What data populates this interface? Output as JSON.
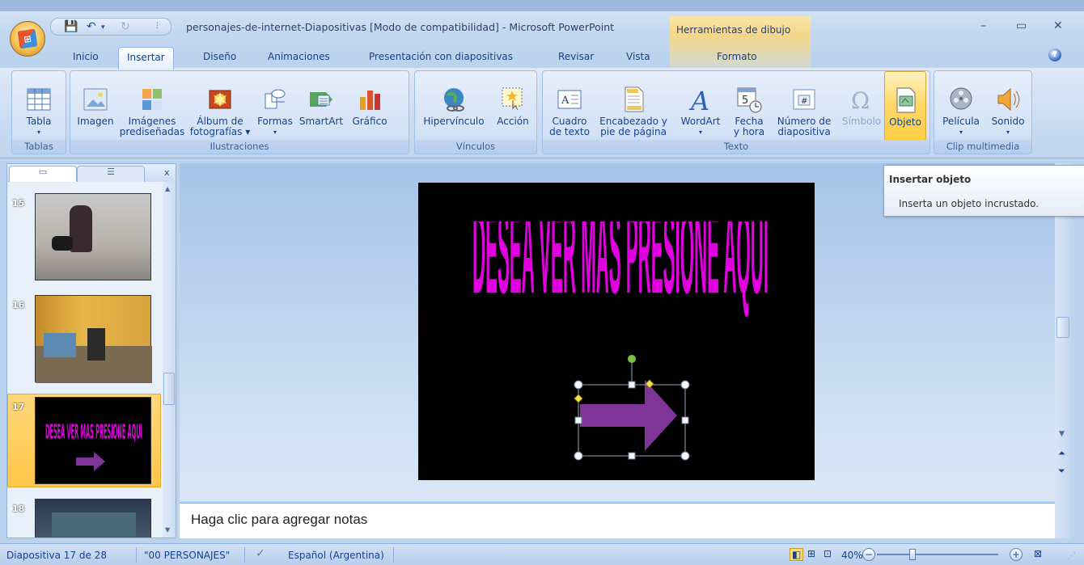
{
  "window": {
    "title": "personajes-de-internet-Diapositivas [Modo de compatibilidad] - Microsoft PowerPoint",
    "context_group": "Herramientas de dibujo"
  },
  "tabs": [
    "Inicio",
    "Insertar",
    "Diseño",
    "Animaciones",
    "Presentación con diapositivas",
    "Revisar",
    "Vista",
    "Formato"
  ],
  "ribbon": {
    "groups": {
      "tablas": "Tablas",
      "ilustraciones": "Ilustraciones",
      "vinculos": "Vínculos",
      "texto": "Texto",
      "clip": "Clip multimedia"
    },
    "buttons": {
      "tabla": "Tabla",
      "imagen": "Imagen",
      "imagenes_1": "Imágenes",
      "imagenes_2": "prediseñadas",
      "album_1": "Álbum de",
      "album_2": "fotografías",
      "formas": "Formas",
      "smartart": "SmartArt",
      "grafico": "Gráfico",
      "hipervinculo": "Hipervínculo",
      "accion": "Acción",
      "cuadro_1": "Cuadro",
      "cuadro_2": "de texto",
      "encabezado_1": "Encabezado y",
      "encabezado_2": "pie de página",
      "wordart": "WordArt",
      "fecha_1": "Fecha",
      "fecha_2": "y hora",
      "numero_1": "Número de",
      "numero_2": "diapositiva",
      "simbolo": "Símbolo",
      "objeto": "Objeto",
      "pelicula": "Película",
      "sonido": "Sonido"
    }
  },
  "tooltip": {
    "title": "Insertar objeto",
    "description": "Inserta un objeto incrustado."
  },
  "thumbnails": [
    {
      "number": "15"
    },
    {
      "number": "16"
    },
    {
      "number": "17"
    },
    {
      "number": "18"
    }
  ],
  "slide": {
    "wordart_text": "DESEA VER MAS PRESIONE AQUI",
    "wordart_color": "#e000e0",
    "arrow_color": "#7f3598"
  },
  "notes": {
    "placeholder": "Haga clic para agregar notas"
  },
  "status": {
    "slide": "Diapositiva 17 de 28",
    "theme": "\"00 PERSONAJES\"",
    "language": "Español (Argentina)",
    "zoom": "40%"
  },
  "colors": {
    "ribbon_bg": "#c7daf3",
    "accent": "#15428b",
    "highlight": "#ffd96b"
  }
}
